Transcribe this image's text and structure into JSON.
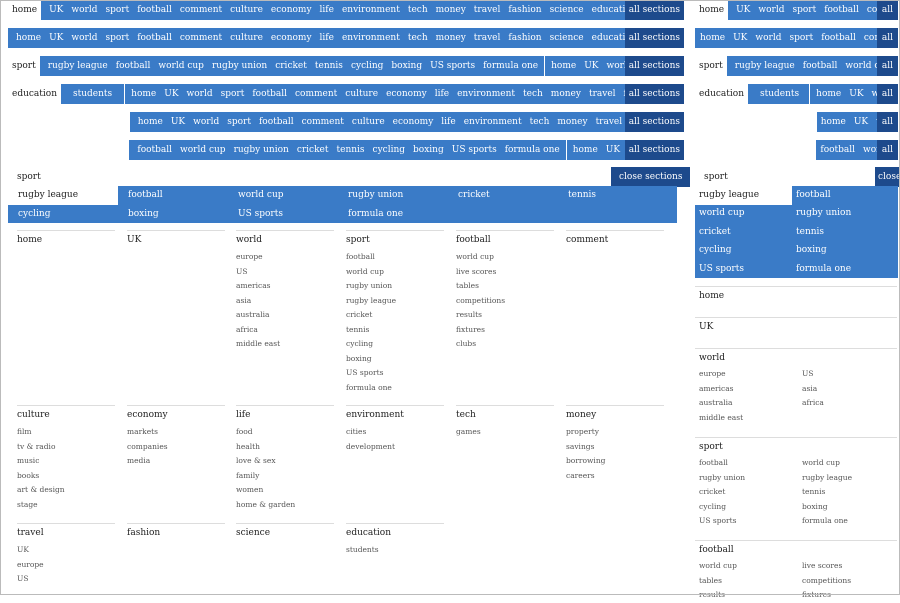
{
  "sections_full": [
    "home",
    "UK",
    "world",
    "sport",
    "football",
    "comment",
    "culture",
    "economy",
    "life",
    "environment",
    "tech",
    "money",
    "travel",
    "fashion",
    "science",
    "education"
  ],
  "all_sections": "all sections",
  "close_sections": "close sections",
  "close_short": "close",
  "all_short": "all",
  "sport_subs": [
    "rugby league",
    "football",
    "world cup",
    "rugby union",
    "cricket",
    "tennis",
    "cycling",
    "boxing",
    "US sports",
    "formula one"
  ],
  "education_subs": [
    "students"
  ],
  "labels": {
    "home": "home",
    "sport": "sport",
    "education": "education",
    "students": "students",
    "rugby_league": "rugby league",
    "chev": "›"
  },
  "menu_cols": [
    {
      "h": "home",
      "items": []
    },
    {
      "h": "UK",
      "items": []
    },
    {
      "h": "world",
      "items": [
        "europe",
        "US",
        "americas",
        "asia",
        "australia",
        "africa",
        "middle east"
      ]
    },
    {
      "h": "sport",
      "items": [
        "football",
        "world cup",
        "rugby union",
        "rugby league",
        "cricket",
        "tennis",
        "cycling",
        "boxing",
        "US sports",
        "formula one"
      ]
    },
    {
      "h": "football",
      "items": [
        "world cup",
        "live scores",
        "tables",
        "competitions",
        "results",
        "fixtures",
        "clubs"
      ]
    },
    {
      "h": "comment",
      "items": []
    },
    {
      "h": "culture",
      "items": [
        "film",
        "tv & radio",
        "music",
        "books",
        "art & design",
        "stage"
      ]
    },
    {
      "h": "economy",
      "items": [
        "markets",
        "companies",
        "media"
      ]
    },
    {
      "h": "life",
      "items": [
        "food",
        "health",
        "love & sex",
        "family",
        "women",
        "home & garden"
      ]
    },
    {
      "h": "environment",
      "items": [
        "cities",
        "development"
      ]
    },
    {
      "h": "tech",
      "items": [
        "games"
      ]
    },
    {
      "h": "money",
      "items": [
        "property",
        "savings",
        "borrowing",
        "careers"
      ]
    },
    {
      "h": "travel",
      "items": [
        "UK",
        "europe",
        "US"
      ]
    },
    {
      "h": "fashion",
      "items": []
    },
    {
      "h": "science",
      "items": []
    },
    {
      "h": "education",
      "items": [
        "students"
      ]
    }
  ],
  "right_sections": [
    {
      "h": "home",
      "left": [],
      "right": []
    },
    {
      "h": "UK",
      "left": [],
      "right": []
    },
    {
      "h": "world",
      "left": [
        "europe",
        "americas",
        "australia",
        "middle east"
      ],
      "right": [
        "US",
        "asia",
        "africa"
      ]
    },
    {
      "h": "sport",
      "left": [
        "football",
        "rugby union",
        "cricket",
        "cycling",
        "US sports"
      ],
      "right": [
        "world cup",
        "rugby league",
        "tennis",
        "boxing",
        "formula one"
      ]
    },
    {
      "h": "football",
      "left": [
        "world cup",
        "tables",
        "results"
      ],
      "right": [
        "live scores",
        "competitions",
        "fixtures"
      ]
    }
  ]
}
